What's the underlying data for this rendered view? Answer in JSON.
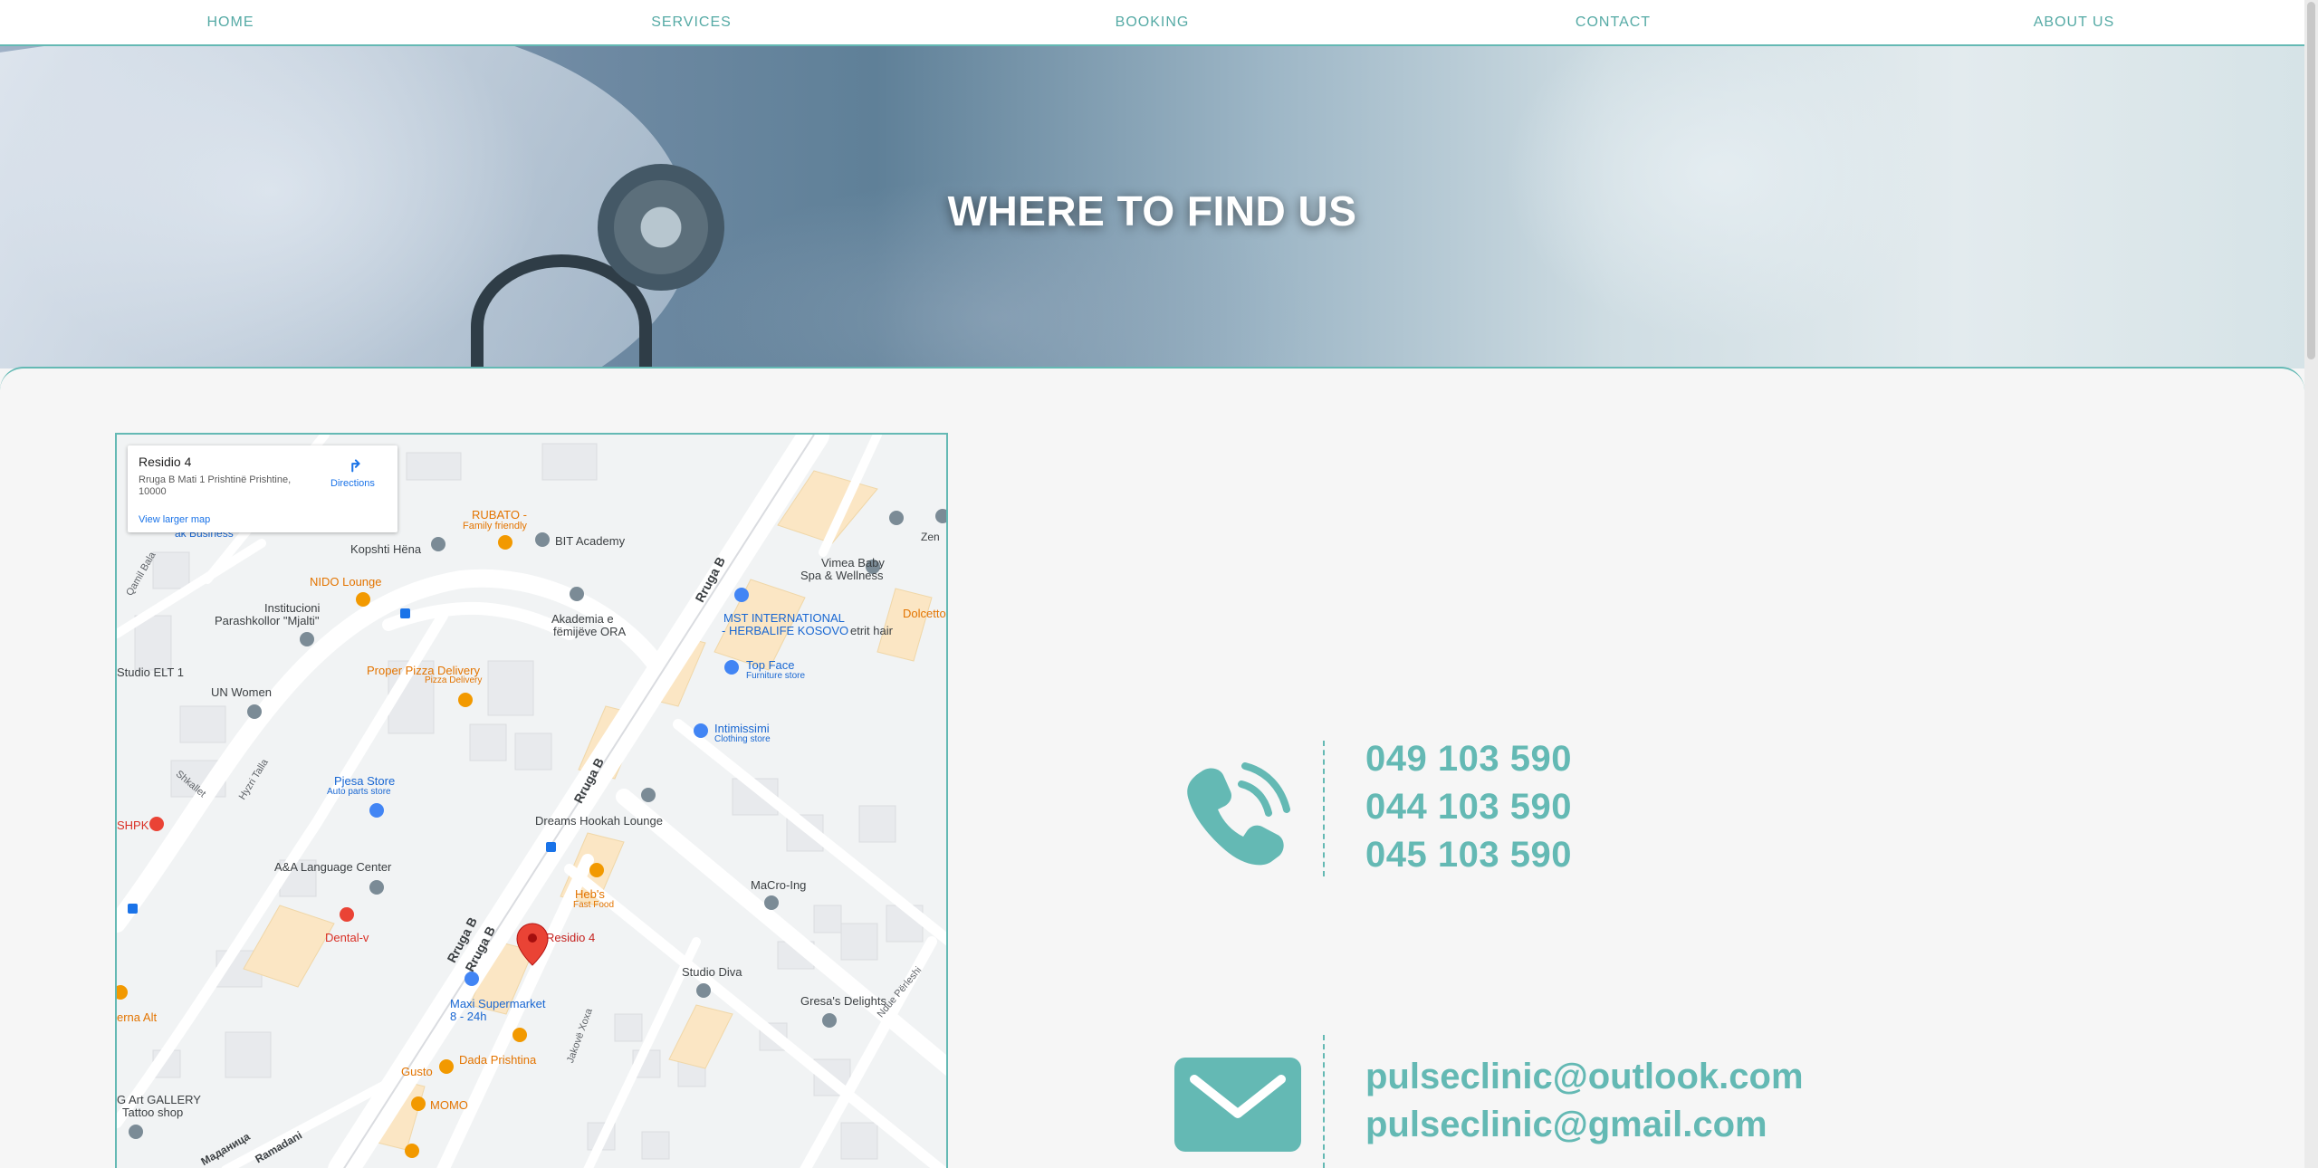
{
  "nav": {
    "items": [
      {
        "label": "HOME"
      },
      {
        "label": "SERVICES"
      },
      {
        "label": "BOOKING"
      },
      {
        "label": "CONTACT"
      },
      {
        "label": "ABOUT US"
      }
    ]
  },
  "hero": {
    "title": "WHERE TO FIND US"
  },
  "map": {
    "place_name": "Residio 4",
    "address": "Rruga B Mati 1 Prishtinë Prishtine, 10000",
    "directions_label": "Directions",
    "view_larger_label": "View larger map",
    "pin_label": "Residio 4",
    "labels": [
      "Kopshti Hëna",
      "RUBATO -",
      "Family friendly",
      "BIT Academy",
      "Vimea Baby",
      "Spa & Wellness",
      "NIDO Lounge",
      "Institucioni",
      "Parashkollor \"Mjalti\"",
      "Akademia e",
      "fëmijëve ORA",
      "MST INTERNATIONAL",
      "- HERBALIFE KOSOVO",
      "etrit hair",
      "Dolcetto",
      "Zen",
      "Studio ELT 1",
      "Proper Pizza Delivery",
      "Pizza Delivery",
      "Top Face",
      "Furniture store",
      "UN Women",
      "Intimissimi",
      "Clothing store",
      "Pjesa Store",
      "Auto parts store",
      "Dreams Hookah Lounge",
      "SHPK",
      "A&A Language Center",
      "Heb's",
      "Fast Food",
      "MaCro-Ing",
      "Dental-v",
      "Studio Diva",
      "Gresa's Delights",
      "Maxi Supermarket",
      "8 - 24h",
      "Dada Prishtina",
      "Gusto",
      "MOMO",
      "erna Alt",
      "G Art GALLERY",
      "Tattoo shop",
      "Rruga B",
      "Rruga B",
      "Rruga B",
      "Rruga B",
      "Hyzri Talla",
      "Qamil Bala",
      "Shkallet",
      "Jakovë Xoxa",
      "Ndue Përleshi",
      "ak Business",
      "Маданица",
      "Ramadani"
    ]
  },
  "contact": {
    "phones": [
      "049 103 590",
      "044 103 590",
      "045 103 590"
    ],
    "emails": [
      "pulseclinic@outlook.com",
      "pulseclinic@gmail.com"
    ]
  },
  "colors": {
    "accent": "#64b9b4",
    "background": "#f6f6f6",
    "nav_text": "#55aaa5"
  }
}
